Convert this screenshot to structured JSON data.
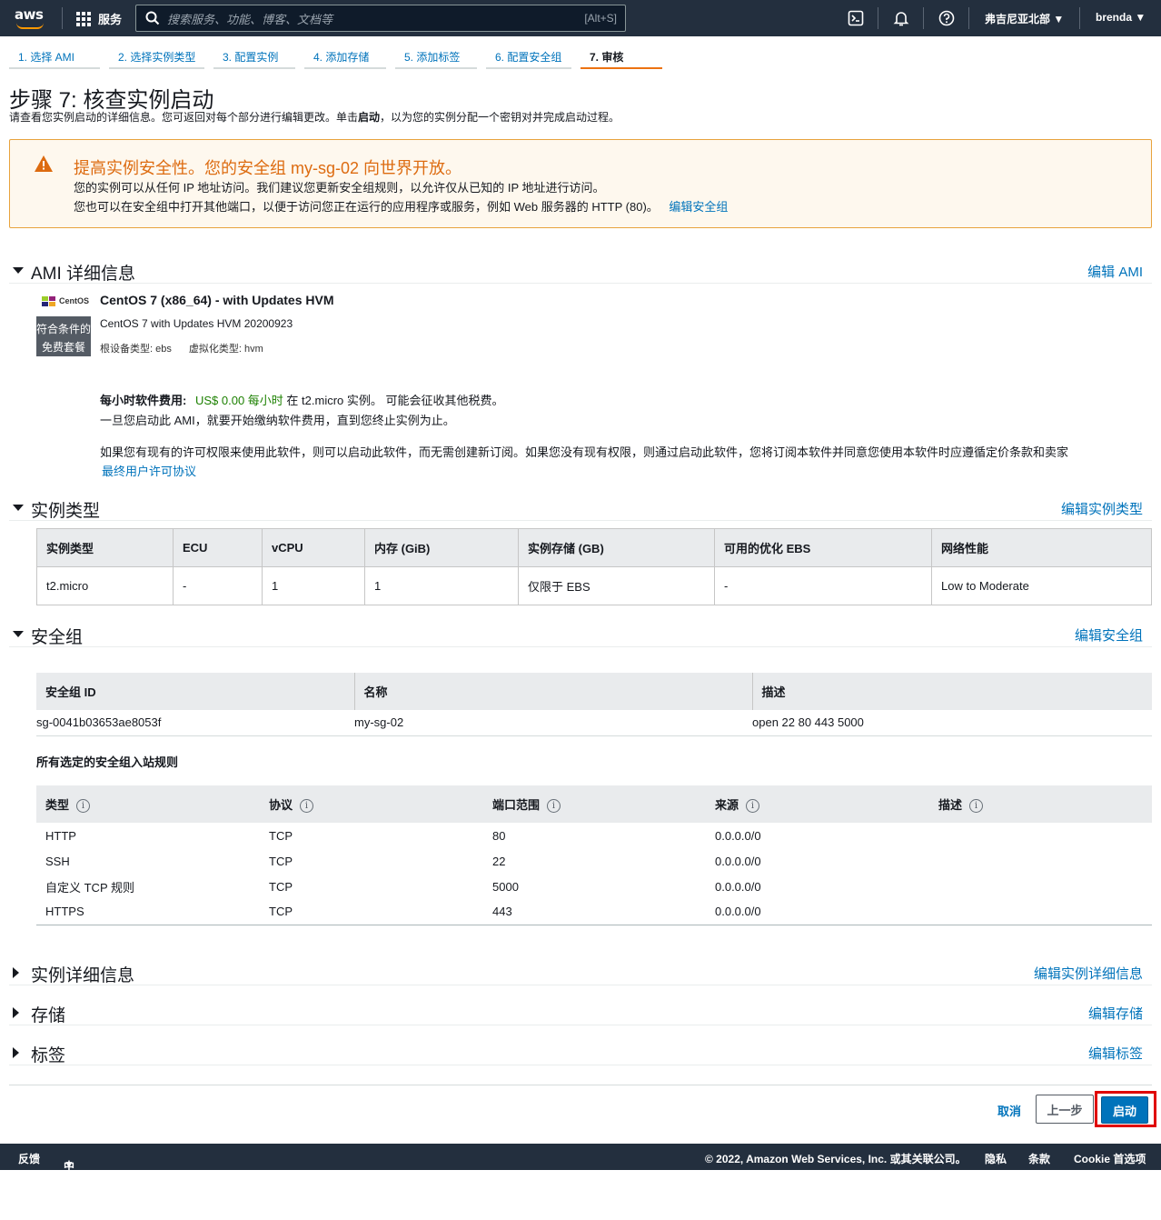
{
  "nav": {
    "logo": "aws",
    "services": "服务",
    "search_placeholder": "搜索服务、功能、博客、文档等",
    "search_hotkey": "[Alt+S]",
    "region": "弗吉尼亚北部",
    "user": "brenda",
    "icons": [
      "terminal-icon",
      "bell-icon",
      "help-icon"
    ]
  },
  "steps": [
    {
      "label": "1. 选择 AMI"
    },
    {
      "label": "2. 选择实例类型"
    },
    {
      "label": "3. 配置实例"
    },
    {
      "label": "4. 添加存储"
    },
    {
      "label": "5. 添加标签"
    },
    {
      "label": "6. 配置安全组"
    },
    {
      "label": "7. 审核"
    }
  ],
  "page": {
    "title": "步骤 7: 核查实例启动",
    "subtitle_a": "请查看您实例启动的详细信息。您可返回对每个部分进行编辑更改。单击",
    "subtitle_bold": "启动",
    "subtitle_b": "，以为您的实例分配一个密钥对并完成启动过程。"
  },
  "warning": {
    "title": "提高实例安全性。您的安全组 my-sg-02 向世界开放。",
    "line1": "您的实例可以从任何 IP 地址访问。我们建议您更新安全组规则，以允许仅从已知的 IP 地址进行访问。",
    "line2": "您也可以在安全组中打开其他端口，以便于访问您正在运行的应用程序或服务，例如 Web 服务器的 HTTP (80)。",
    "link": "编辑安全组"
  },
  "ami": {
    "section": "AMI 详细信息",
    "edit": "编辑 AMI",
    "logo_text": "CentOS",
    "badge_line1": "符合条件的",
    "badge_line2": "免费套餐",
    "name": "CentOS 7 (x86_64) - with Updates HVM",
    "desc": "CentOS 7 with Updates HVM 20200923",
    "root_device": "根设备类型: ebs",
    "virt_type": "虚拟化类型: hvm",
    "price_label": "每小时软件费用:",
    "price_value": "US$ 0.00 每小时",
    "price_rest": "在 t2.micro 实例。 可能会征收其他税费。",
    "price_note": "一旦您启动此 AMI，就要开始缴纳软件费用，直到您终止实例为止。",
    "license_text": "如果您有现有的许可权限来使用此软件，则可以启动此软件，而无需创建新订阅。如果您没有现有权限，则通过启动此软件，您将订阅本软件并同意您使用本软件时应遵循定价条款和卖家",
    "license_link": "最终用户许可协议"
  },
  "instance_type": {
    "section": "实例类型",
    "edit": "编辑实例类型",
    "headers": [
      "实例类型",
      "ECU",
      "vCPU",
      "内存 (GiB)",
      "实例存储 (GB)",
      "可用的优化 EBS",
      "网络性能"
    ],
    "row": [
      "t2.micro",
      "-",
      "1",
      "1",
      "仅限于 EBS",
      "-",
      "Low to Moderate"
    ]
  },
  "security": {
    "section": "安全组",
    "edit": "编辑安全组",
    "sg_headers": [
      "安全组 ID",
      "名称",
      "描述"
    ],
    "sg_row": [
      "sg-0041b03653ae8053f",
      "my-sg-02",
      "open 22 80 443 5000"
    ],
    "rules_label": "所有选定的安全组入站规则",
    "rule_headers": [
      "类型",
      "协议",
      "端口范围",
      "来源",
      "描述"
    ],
    "rules": [
      [
        "HTTP",
        "TCP",
        "80",
        "0.0.0.0/0",
        ""
      ],
      [
        "SSH",
        "TCP",
        "22",
        "0.0.0.0/0",
        ""
      ],
      [
        "自定义 TCP 规则",
        "TCP",
        "5000",
        "0.0.0.0/0",
        ""
      ],
      [
        "HTTPS",
        "TCP",
        "443",
        "0.0.0.0/0",
        ""
      ]
    ]
  },
  "collapsed": [
    {
      "title": "实例详细信息",
      "edit": "编辑实例详细信息"
    },
    {
      "title": "存储",
      "edit": "编辑存储"
    },
    {
      "title": "标签",
      "edit": "编辑标签"
    }
  ],
  "actions": {
    "cancel": "取消",
    "previous": "上一步",
    "launch": "启动"
  },
  "footer": {
    "feedback": "反馈",
    "language": "中文(简体)",
    "copyright": "© 2022, Amazon Web Services, Inc. 或其关联公司。",
    "privacy": "隐私",
    "terms": "条款",
    "cookie": "Cookie 首选项"
  }
}
